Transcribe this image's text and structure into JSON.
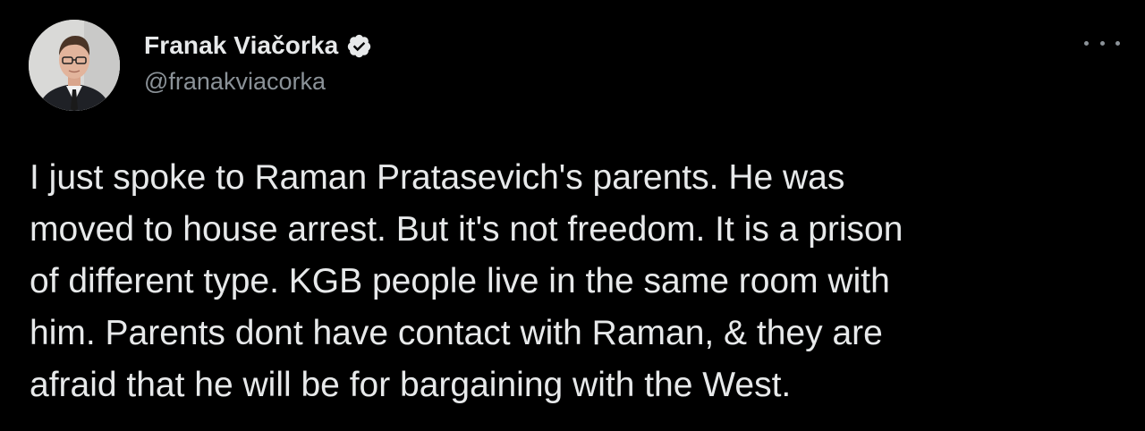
{
  "author": {
    "display_name": "Franak Viačorka",
    "handle": "@franakviacorka",
    "verified_icon": "verified-badge-icon",
    "avatar_icon": "profile-photo"
  },
  "menu": {
    "icon": "more-options-icon"
  },
  "tweet": {
    "lines": [
      "I just spoke to Raman Pratasevich's parents. He was",
      "moved to house arrest. But it's not freedom. It is a prison",
      "of different type. KGB people live in the same room with",
      "him. Parents dont have contact with Raman, & they are",
      "afraid that he will be for bargaining with the West."
    ]
  },
  "colors": {
    "background": "#000000",
    "text_primary": "#e7e9ea",
    "text_secondary": "#8b9298"
  }
}
